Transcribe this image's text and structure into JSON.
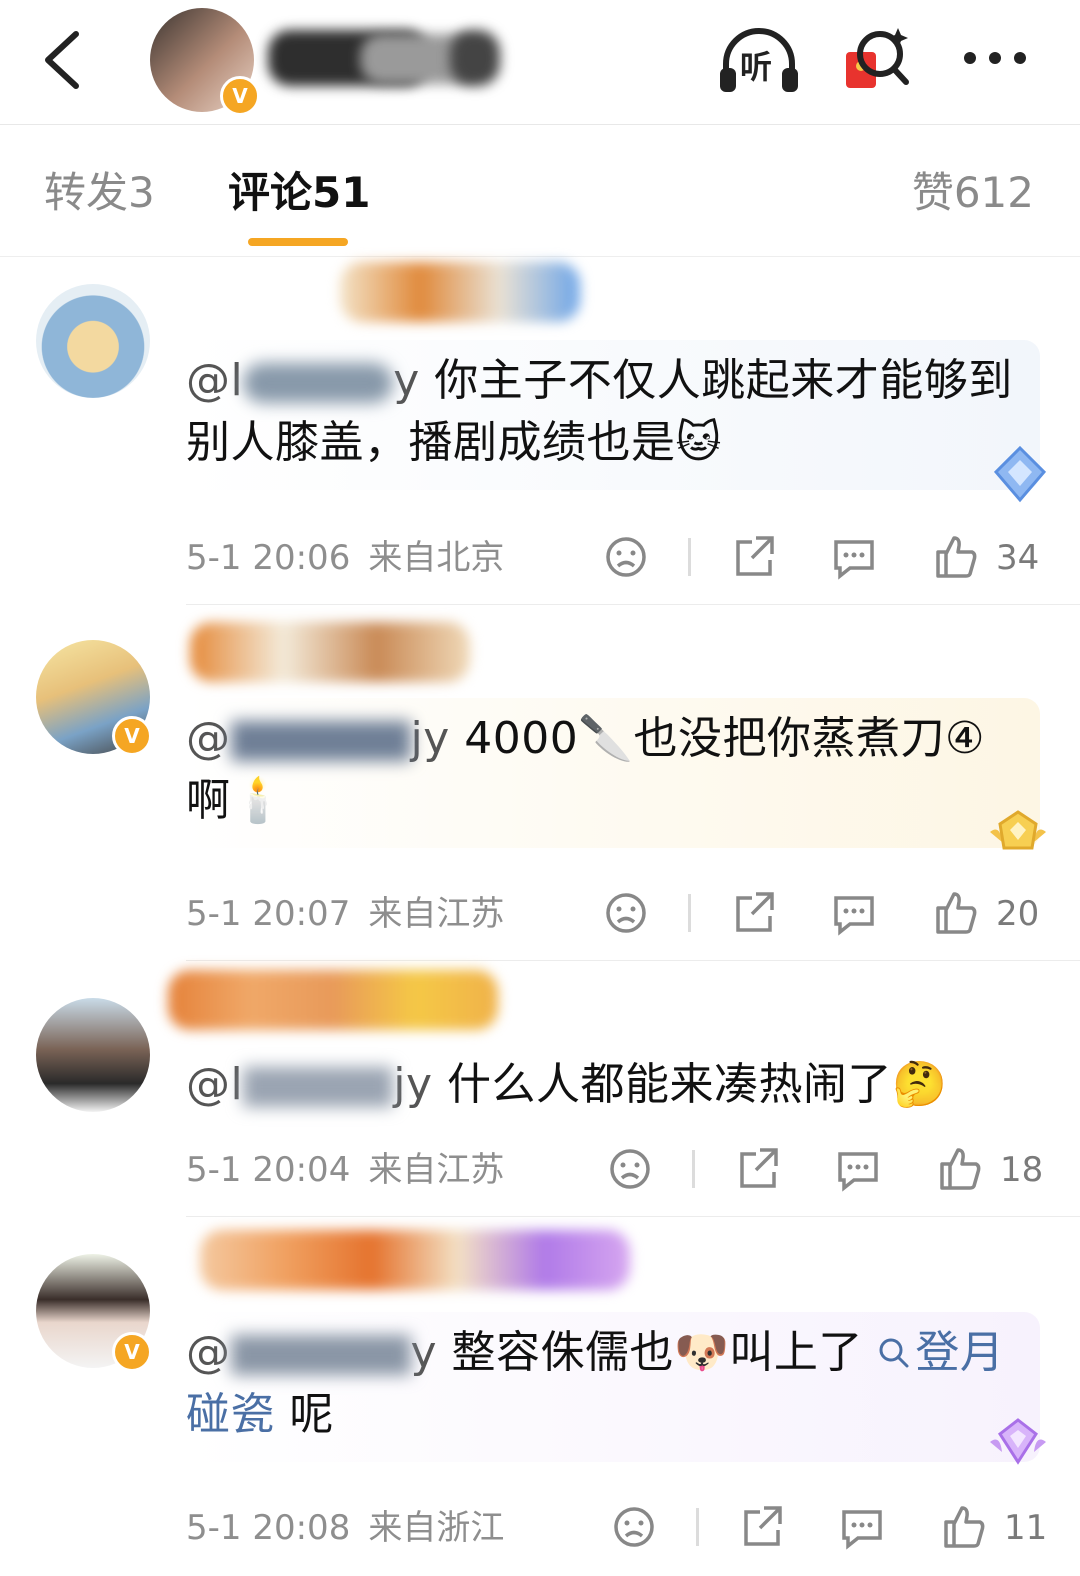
{
  "tabs": {
    "repost": "转发3",
    "comment": "评论51",
    "like": "赞612"
  },
  "header": {
    "listen_label": "听",
    "badge": "V"
  },
  "comments": [
    {
      "mention_start": "@l",
      "mention_end": "y",
      "text": "你主子不仅人跳起来才能够到别人膝盖，播剧成绩也是",
      "time": "5-1 20:06",
      "location": "来自北京",
      "likes": "34"
    },
    {
      "mention_start": "@",
      "mention_end": "jy",
      "text": "4000🔪也没把你蒸煮刀④啊",
      "time": "5-1 20:07",
      "location": "来自江苏",
      "likes": "20"
    },
    {
      "mention_start": "@l",
      "mention_end": "jy",
      "text": "什么人都能来凑热闹了",
      "time": "5-1 20:04",
      "location": "来自江苏",
      "likes": "18"
    },
    {
      "mention_start": "@",
      "mention_end": "y",
      "text": "整容侏儒也🐶叫上了",
      "search_link": "登月碰瓷",
      "text_after": " 呢",
      "time": "5-1 20:08",
      "location": "来自浙江",
      "likes": "11"
    }
  ]
}
